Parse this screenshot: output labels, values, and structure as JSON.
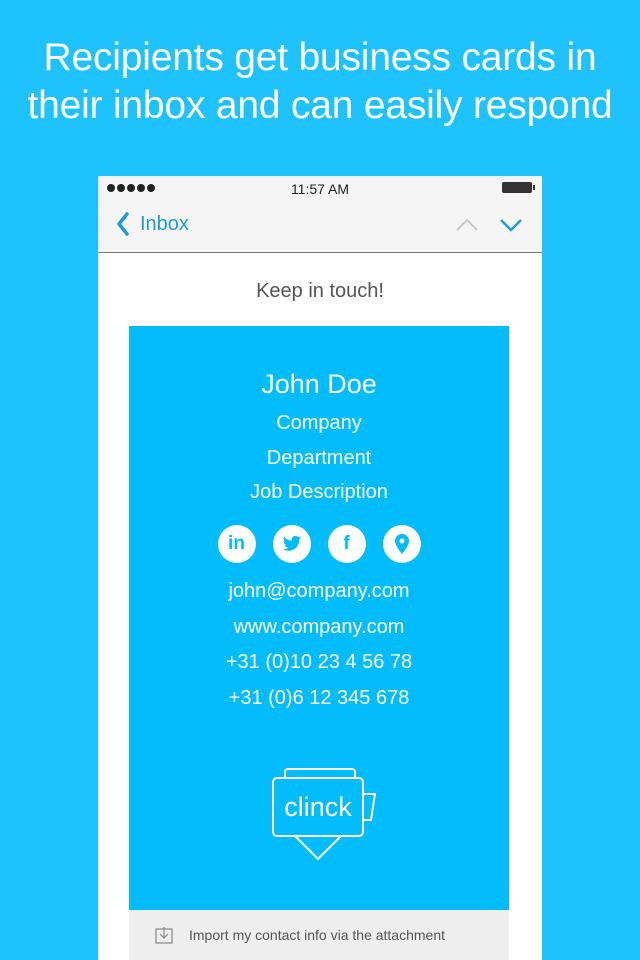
{
  "headline": {
    "line1": "Recipients get business cards in",
    "line2": "their inbox and can easily respond"
  },
  "status_bar": {
    "time": "11:57 AM",
    "signal_icon": "signal-dots-icon",
    "battery_icon": "battery-icon"
  },
  "nav": {
    "back_label": "Inbox",
    "back_icon": "chevron-left-icon",
    "prev_icon": "chevron-up-icon",
    "next_icon": "chevron-down-icon"
  },
  "email": {
    "subject": "Keep in touch!"
  },
  "card": {
    "name": "John Doe",
    "company": "Company",
    "department": "Department",
    "job": "Job Description",
    "socials": [
      {
        "name": "linkedin",
        "label": "in"
      },
      {
        "name": "twitter",
        "label": ""
      },
      {
        "name": "facebook",
        "label": "f"
      },
      {
        "name": "location",
        "label": ""
      }
    ],
    "email": "john@company.com",
    "website": "www.company.com",
    "phone1": "+31 (0)10 23 4 56 78",
    "phone2": "+31 (0)6 12 345 678",
    "logo_text": "clinck"
  },
  "import_bar": {
    "label": "Import my contact info via the attachment",
    "icon": "download-icon"
  },
  "colors": {
    "background": "#1ec3fd",
    "card": "#02bcfb",
    "accent": "#1f9bde"
  }
}
